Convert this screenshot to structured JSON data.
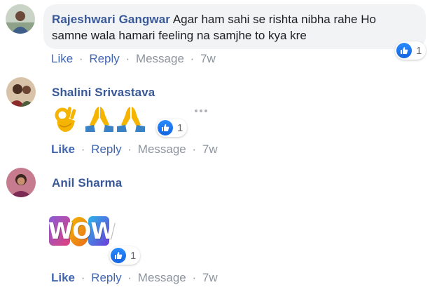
{
  "comments": [
    {
      "author": "Rajeshwari Gangwar",
      "text_line1": "Agar ham sahi se rishta nibha rahe Ho",
      "text_line2": "samne wala hamari feeling na samjhe to kya kre",
      "reaction_count": "1",
      "actions": {
        "like": "Like",
        "reply": "Reply",
        "message": "Message",
        "time": "7w"
      }
    },
    {
      "author": "Shalini Srivastava",
      "emojis": [
        "ok-hand-emoji",
        "folded-hands-emoji",
        "folded-hands-emoji"
      ],
      "reaction_count": "1",
      "actions": {
        "like": "Like",
        "reply": "Reply",
        "message": "Message",
        "time": "7w"
      }
    },
    {
      "author": "Anil Sharma",
      "sticker_text": "WOW",
      "reaction_count": "1",
      "actions": {
        "like": "Like",
        "reply": "Reply",
        "message": "Message",
        "time": "7w"
      }
    }
  ],
  "separator": "·",
  "colors": {
    "name": "#385898",
    "link": "#4267b2",
    "meta": "#8d949e",
    "bubble": "#f2f3f5",
    "like": "#1877f2"
  }
}
